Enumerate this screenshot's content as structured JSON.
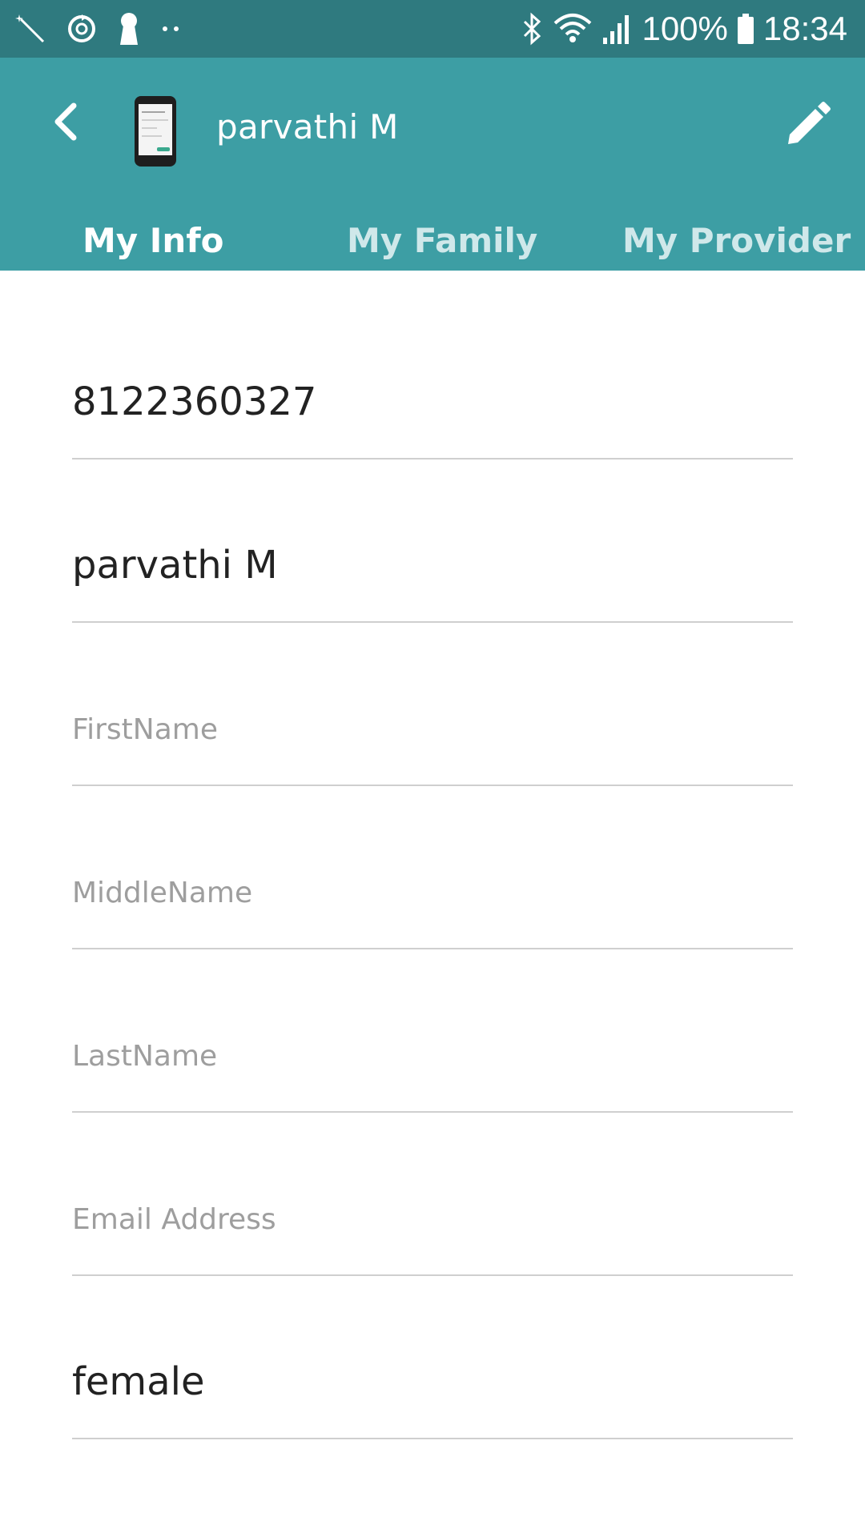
{
  "status_bar": {
    "battery": "100%",
    "time": "18:34",
    "left_icons": [
      "magic-wand-icon",
      "sync-icon",
      "keyhole-icon",
      "dots-icon"
    ],
    "right_icons": [
      "bluetooth-icon",
      "wifi-icon",
      "signal-icon",
      "battery-icon"
    ]
  },
  "app_bar": {
    "title": "parvathi M",
    "back_icon": "chevron-left-icon",
    "edit_icon": "pencil-icon"
  },
  "tabs": [
    {
      "label": "My Info",
      "active": true
    },
    {
      "label": "My Family",
      "active": false
    },
    {
      "label": "My Provider",
      "active": false
    }
  ],
  "form": {
    "phone": {
      "value": "8122360327",
      "placeholder": ""
    },
    "display_name": {
      "value": "parvathi M",
      "placeholder": ""
    },
    "first_name": {
      "value": "",
      "placeholder": "FirstName"
    },
    "middle_name": {
      "value": "",
      "placeholder": "MiddleName"
    },
    "last_name": {
      "value": "",
      "placeholder": "LastName"
    },
    "email": {
      "value": "",
      "placeholder": "Email Address"
    },
    "gender": {
      "value": "female",
      "placeholder": ""
    }
  },
  "colors": {
    "status_bar": "#2f7a7f",
    "app_bar": "#3d9ea4",
    "tab_active": "#ffffff",
    "tab_inactive": "#cfe8ea",
    "divider": "#cfcfcf",
    "placeholder": "#9e9e9e",
    "text": "#222222"
  }
}
